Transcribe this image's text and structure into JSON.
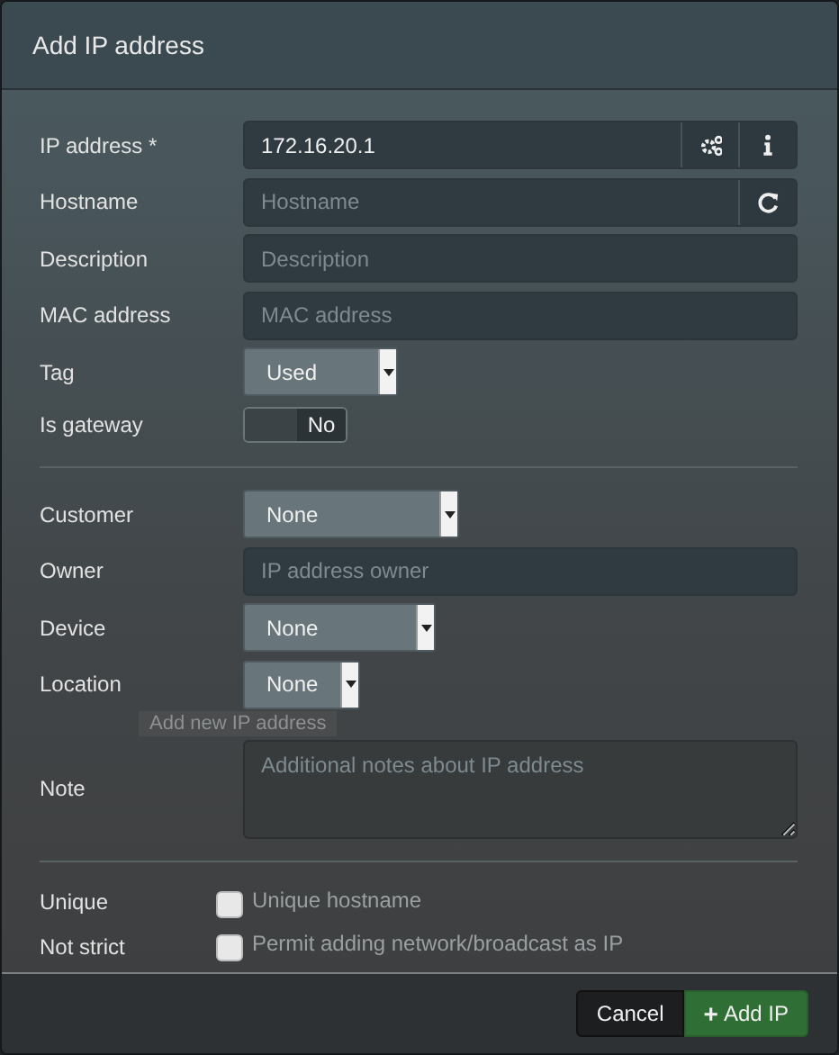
{
  "window": {
    "title": "Add IP address"
  },
  "sections": [
    {
      "fields": [
        {
          "kind": "input",
          "label": "IP address *",
          "value": "172.16.20.1",
          "addons": [
            {
              "kind": "gears"
            },
            {
              "kind": "info"
            }
          ]
        },
        {
          "kind": "input",
          "label": "Hostname",
          "placeholder": "Hostname",
          "addons": [
            {
              "kind": "refresh"
            }
          ]
        },
        {
          "kind": "input",
          "label": "Description",
          "placeholder": "Description"
        },
        {
          "kind": "input",
          "label": "MAC address",
          "placeholder": "MAC address"
        },
        {
          "kind": "select",
          "label": "Tag",
          "value": "Used"
        },
        {
          "kind": "toggle",
          "label": "Is gateway",
          "on": false,
          "text": "No"
        }
      ]
    },
    {
      "fields": [
        {
          "kind": "select",
          "label": "Customer",
          "value": "None"
        },
        {
          "kind": "input",
          "label": "Owner",
          "placeholder": "IP address owner"
        },
        {
          "kind": "select",
          "label": "Device",
          "value": "None"
        },
        {
          "kind": "select",
          "label": "Location",
          "value": "None",
          "tooltip": "Add new IP address"
        },
        {
          "kind": "textarea",
          "label": "Note",
          "placeholder": "Additional notes about IP address"
        }
      ]
    },
    {
      "fields": [
        {
          "kind": "checkbox",
          "label": "Unique",
          "text": "Unique hostname",
          "checked": false
        },
        {
          "kind": "checkbox",
          "label": "Not strict",
          "text": "Permit adding network/broadcast as IP",
          "checked": false
        }
      ]
    }
  ],
  "buttons": [
    {
      "kind": "cancel",
      "label": "Cancel"
    },
    {
      "kind": "primary",
      "icon": "+",
      "label": "Add IP"
    }
  ]
}
